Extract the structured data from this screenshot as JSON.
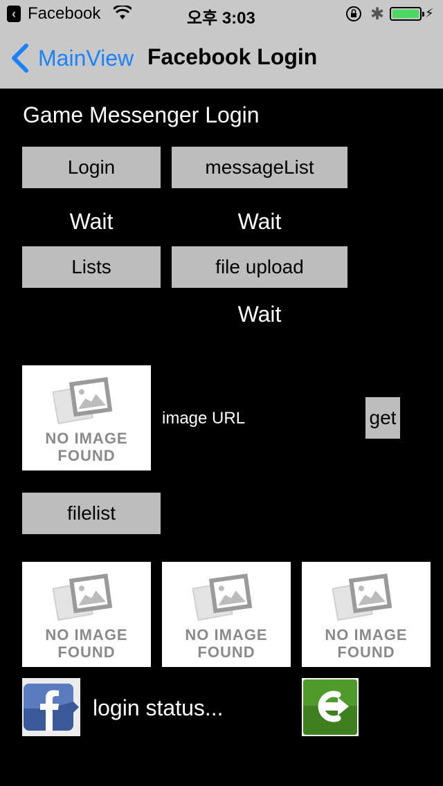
{
  "status_bar": {
    "app_name": "Facebook",
    "time": "오후 3:03",
    "battery_level": 1.0,
    "icons": [
      "back-app-icon",
      "wifi-icon",
      "orientation-lock-icon",
      "bluetooth-icon",
      "battery-icon",
      "charging-icon"
    ]
  },
  "nav": {
    "back_label": "MainView",
    "title": "Facebook Login",
    "back_color": "#1a82fb"
  },
  "content": {
    "header": "Game Messenger Login",
    "login_button": "Login",
    "messagelist_button": "messageList",
    "wait_1": "Wait",
    "wait_2": "Wait",
    "lists_button": "Lists",
    "file_upload_button": "file upload",
    "wait_3": "Wait",
    "image_url_label": "image URL",
    "get_button": "get",
    "filelist_button": "filelist",
    "no_image_line1": "NO IMAGE",
    "no_image_line2": "FOUND",
    "login_status": "login status..."
  }
}
